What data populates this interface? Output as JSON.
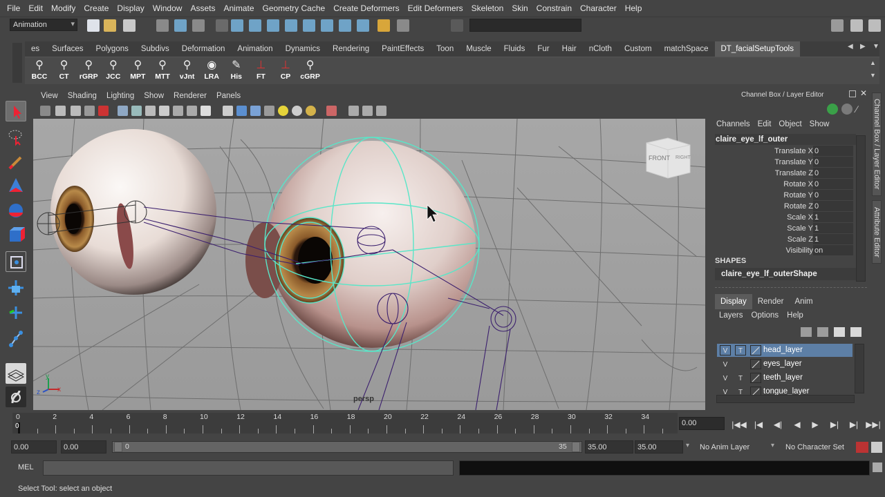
{
  "menubar": [
    "File",
    "Edit",
    "Modify",
    "Create",
    "Display",
    "Window",
    "Assets",
    "Animate",
    "Geometry Cache",
    "Create Deformers",
    "Edit Deformers",
    "Skeleton",
    "Skin",
    "Constrain",
    "Character",
    "Help"
  ],
  "status": {
    "mode": "Animation"
  },
  "shelf": {
    "tabs": [
      "es",
      "Surfaces",
      "Polygons",
      "Subdivs",
      "Deformation",
      "Animation",
      "Dynamics",
      "Rendering",
      "PaintEffects",
      "Toon",
      "Muscle",
      "Fluids",
      "Fur",
      "Hair",
      "nCloth",
      "Custom",
      "matchSpace",
      "DT_facialSetupTools"
    ],
    "active_tab": "DT_facialSetupTools",
    "buttons": [
      "BCC",
      "CT",
      "rGRP",
      "JCC",
      "MPT",
      "MTT",
      "vJnt",
      "LRA",
      "His",
      "FT",
      "CP",
      "cGRP"
    ]
  },
  "viewport": {
    "menu": [
      "View",
      "Shading",
      "Lighting",
      "Show",
      "Renderer",
      "Panels"
    ],
    "camera_label": "persp",
    "viewcube": {
      "front": "FRONT",
      "right": "RIGHT"
    },
    "axis": {
      "y": "y",
      "z": "z",
      "x": "x"
    }
  },
  "channel_box": {
    "title": "Channel Box / Layer Editor",
    "menu": [
      "Channels",
      "Edit",
      "Object",
      "Show"
    ],
    "object": "claire_eye_lf_outer",
    "channels": [
      {
        "name": "Translate X",
        "value": "0"
      },
      {
        "name": "Translate Y",
        "value": "0"
      },
      {
        "name": "Translate Z",
        "value": "0"
      },
      {
        "name": "Rotate X",
        "value": "0"
      },
      {
        "name": "Rotate Y",
        "value": "0"
      },
      {
        "name": "Rotate Z",
        "value": "0"
      },
      {
        "name": "Scale X",
        "value": "1"
      },
      {
        "name": "Scale Y",
        "value": "1"
      },
      {
        "name": "Scale Z",
        "value": "1"
      },
      {
        "name": "Visibility",
        "value": "on"
      }
    ],
    "shapes_label": "SHAPES",
    "shape": "claire_eye_lf_outerShape"
  },
  "layer_editor": {
    "tabs": [
      "Display",
      "Render",
      "Anim"
    ],
    "active_tab": "Display",
    "menu": [
      "Layers",
      "Options",
      "Help"
    ],
    "layers": [
      {
        "v": "V",
        "t": "T",
        "name": "head_layer",
        "selected": true
      },
      {
        "v": "V",
        "t": "",
        "name": "eyes_layer",
        "selected": false
      },
      {
        "v": "V",
        "t": "T",
        "name": "teeth_layer",
        "selected": false
      },
      {
        "v": "V",
        "t": "T",
        "name": "tongue_layer",
        "selected": false
      }
    ]
  },
  "side_tabs": [
    "Channel Box / Layer Editor",
    "Attribute Editor"
  ],
  "timeline": {
    "ticks": [
      "0",
      "2",
      "4",
      "6",
      "8",
      "10",
      "12",
      "14",
      "16",
      "18",
      "20",
      "22",
      "24",
      "26",
      "28",
      "30",
      "32",
      "34"
    ],
    "current_frame_marker": "0",
    "current_time": "0.00"
  },
  "range": {
    "start": "0.00",
    "playback_start": "0.00",
    "bar_start": "0",
    "bar_end": "35",
    "playback_end": "35.00",
    "end": "35.00",
    "anim_layer": "No Anim Layer",
    "character_set": "No Character Set"
  },
  "command": {
    "label": "MEL"
  },
  "help_line": "Select Tool: select an object",
  "colors": {
    "selection_cyan": "#59e6c8",
    "layer_sel": "#5d7fa6",
    "joint_purple": "#3b1f6e"
  }
}
